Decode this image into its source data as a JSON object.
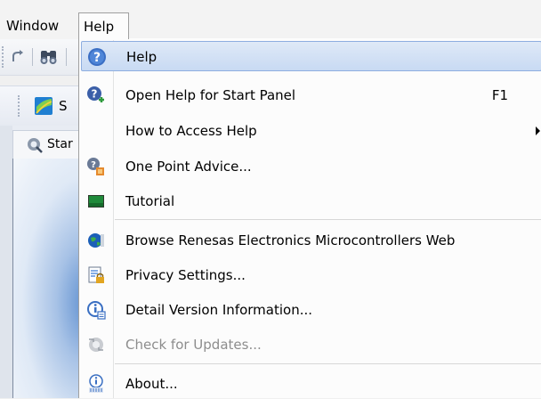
{
  "menubar": {
    "items": [
      {
        "label": "Window"
      },
      {
        "label": "Help"
      }
    ]
  },
  "toolbar": {
    "search_icon": "binoculars-icon",
    "redo_icon": "redo-icon",
    "partial_label": "S"
  },
  "document_tab": {
    "label": "Star",
    "icon": "start-panel-icon"
  },
  "help_menu": {
    "items": [
      {
        "label": "Help",
        "icon": "help-question-icon",
        "highlighted": true
      },
      {
        "label": "Open Help for Start Panel",
        "shortcut": "F1",
        "icon": "help-context-icon"
      },
      {
        "label": "How to Access Help",
        "submenu": true
      },
      {
        "label": "One Point Advice...",
        "icon": "advice-icon"
      },
      {
        "label": "Tutorial",
        "icon": "tutorial-icon"
      },
      {
        "label": "Browse Renesas Electronics Microcontrollers Web",
        "icon": "web-globe-icon"
      },
      {
        "label": "Privacy Settings...",
        "icon": "privacy-lock-icon"
      },
      {
        "label": "Detail Version Information...",
        "icon": "version-info-icon"
      },
      {
        "label": "Check for Updates...",
        "icon": "update-check-icon",
        "disabled": true
      },
      {
        "label": "About...",
        "icon": "about-info-icon"
      }
    ]
  },
  "colors": {
    "highlight": "#c8daf3",
    "highlight_border": "#8eaee0",
    "disabled_text": "#8d8d8d",
    "menu_background": "#fcfcfc"
  }
}
